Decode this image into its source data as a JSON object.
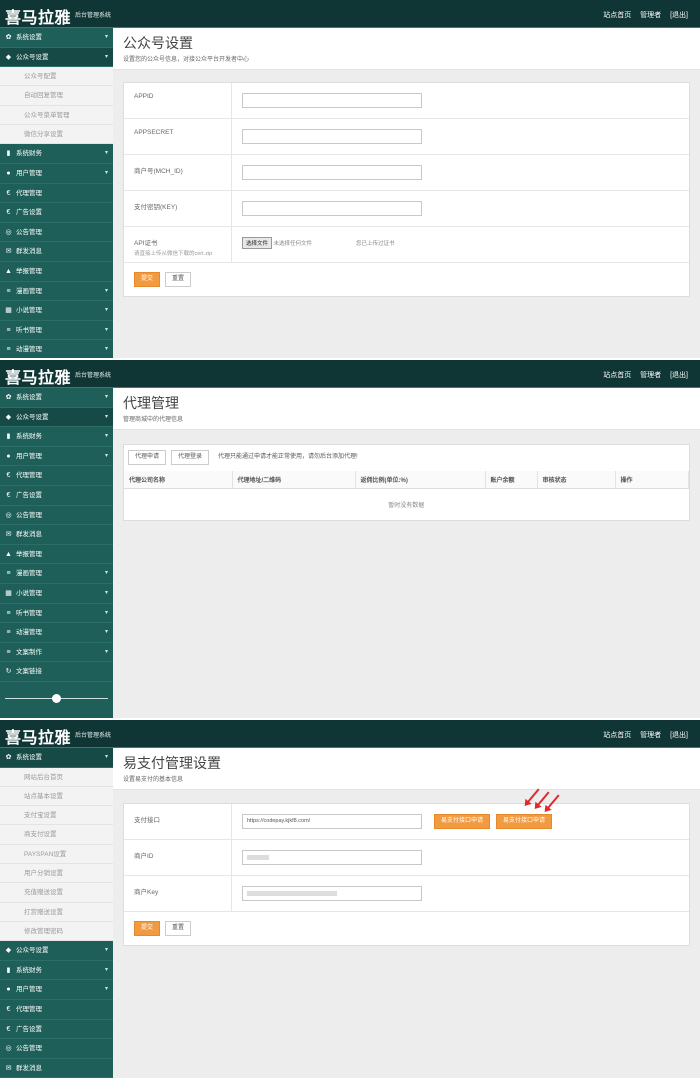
{
  "brand": "喜马拉雅",
  "brand_sub": "后台管理系统",
  "topnav": {
    "home": "站点首页",
    "admin": "管理者",
    "logout": "[退出]"
  },
  "panel1": {
    "nav": [
      {
        "icon": "gear-icon",
        "glyph": "✿",
        "label": "系统设置",
        "active": false
      },
      {
        "icon": "tag-icon",
        "glyph": "◆",
        "label": "公众号设置",
        "active": true
      }
    ],
    "subs": [
      "公众号配置",
      "自动回复管理",
      "公众号菜单管理",
      "微信分享设置"
    ],
    "nav_after": [
      {
        "icon": "bar-chart-icon",
        "glyph": "▮",
        "label": "系统财务"
      },
      {
        "icon": "user-icon",
        "glyph": "●",
        "label": "用户管理"
      },
      {
        "icon": "euro-icon",
        "glyph": "€",
        "label": "代理管理"
      },
      {
        "icon": "euro-icon",
        "glyph": "€",
        "label": "广告设置"
      },
      {
        "icon": "bullhorn-icon",
        "glyph": "◎",
        "label": "公告管理"
      },
      {
        "icon": "envelope-icon",
        "glyph": "✉",
        "label": "群发消息"
      },
      {
        "icon": "warning-icon",
        "glyph": "▲",
        "label": "举报管理"
      },
      {
        "icon": "list-icon",
        "glyph": "≡",
        "label": "漫画管理"
      },
      {
        "icon": "grid-icon",
        "glyph": "▦",
        "label": "小说管理"
      },
      {
        "icon": "list-icon",
        "glyph": "≡",
        "label": "听书管理"
      },
      {
        "icon": "list-icon",
        "glyph": "≡",
        "label": "动漫管理"
      }
    ],
    "title": "公众号设置",
    "subtitle": "设置您的公众号信息，对接公众平台开发者中心",
    "fields": [
      {
        "label": "APPID",
        "value": ""
      },
      {
        "label": "APPSECRET",
        "value": ""
      },
      {
        "label": "商户号(MCH_ID)",
        "value": ""
      },
      {
        "label": "支付密钥(KEY)",
        "value": ""
      }
    ],
    "cert_label": "API证书",
    "cert_hint": "请直接上传从微信下载的cert.zip",
    "file_button": "选择文件",
    "file_none": "未选择任何文件",
    "cert_status": "您已上传过证书",
    "submit": "提交",
    "reset": "重置"
  },
  "panel2": {
    "nav": [
      {
        "icon": "gear-icon",
        "glyph": "✿",
        "label": "系统设置",
        "active": false
      },
      {
        "icon": "tag-icon",
        "glyph": "◆",
        "label": "公众号设置",
        "active": true
      },
      {
        "icon": "bar-chart-icon",
        "glyph": "▮",
        "label": "系统财务",
        "active": false
      },
      {
        "icon": "user-icon",
        "glyph": "●",
        "label": "用户管理",
        "active": false
      },
      {
        "icon": "euro-icon",
        "glyph": "€",
        "label": "代理管理",
        "active": false
      },
      {
        "icon": "euro-icon",
        "glyph": "€",
        "label": "广告设置",
        "active": false
      },
      {
        "icon": "bullhorn-icon",
        "glyph": "◎",
        "label": "公告管理",
        "active": false
      },
      {
        "icon": "envelope-icon",
        "glyph": "✉",
        "label": "群发消息",
        "active": false
      },
      {
        "icon": "warning-icon",
        "glyph": "▲",
        "label": "举报管理",
        "active": false
      },
      {
        "icon": "list-icon",
        "glyph": "≡",
        "label": "漫画管理",
        "active": false
      },
      {
        "icon": "grid-icon",
        "glyph": "▦",
        "label": "小说管理",
        "active": false
      },
      {
        "icon": "list-icon",
        "glyph": "≡",
        "label": "听书管理",
        "active": false
      },
      {
        "icon": "list-icon",
        "glyph": "≡",
        "label": "动漫管理",
        "active": false
      },
      {
        "icon": "list-icon",
        "glyph": "≡",
        "label": "文案制作",
        "active": false
      },
      {
        "icon": "refresh-icon",
        "glyph": "↻",
        "label": "文案链接",
        "active": false
      }
    ],
    "title": "代理管理",
    "subtitle": "管理商城中的代理信息",
    "tab_apply": "代理申请",
    "tab_list": "代理登录",
    "notice": "代理只能通过申请才能正常使用，请勿后台添加代理!",
    "columns": [
      "代理公司名称",
      "代理地址/二维码",
      "返佣比例(单位:%)",
      "账户余额",
      "审核状态",
      "操作"
    ],
    "empty": "暂时没有数据"
  },
  "panel3": {
    "nav_top": {
      "icon": "gear-icon",
      "glyph": "✿",
      "label": "系统设置"
    },
    "subs": [
      "网站后台首页",
      "站点基本设置",
      "支付宝设置",
      "商支付设置",
      "PAYSPAN设置",
      "用户分销设置",
      "充值赠送设置",
      "打赏赠送设置",
      "修改管理密码"
    ],
    "nav_after": [
      {
        "icon": "tag-icon",
        "glyph": "◆",
        "label": "公众号设置"
      },
      {
        "icon": "bar-chart-icon",
        "glyph": "▮",
        "label": "系统财务"
      },
      {
        "icon": "user-icon",
        "glyph": "●",
        "label": "用户管理"
      },
      {
        "icon": "euro-icon",
        "glyph": "€",
        "label": "代理管理"
      },
      {
        "icon": "euro-icon",
        "glyph": "€",
        "label": "广告设置"
      },
      {
        "icon": "bullhorn-icon",
        "glyph": "◎",
        "label": "公告管理"
      },
      {
        "icon": "envelope-icon",
        "glyph": "✉",
        "label": "群发消息"
      }
    ],
    "title": "易支付管理设置",
    "subtitle": "设置易支付的基本信息",
    "iface_label": "支付接口",
    "iface_value": "https://codepay.kjkf8.com/",
    "btn_a": "易支付接口申请",
    "btn_b": "易支付接口申请",
    "merchant_id_label": "商户ID",
    "merchant_key_label": "商户Key",
    "submit": "提交",
    "reset": "重置"
  }
}
